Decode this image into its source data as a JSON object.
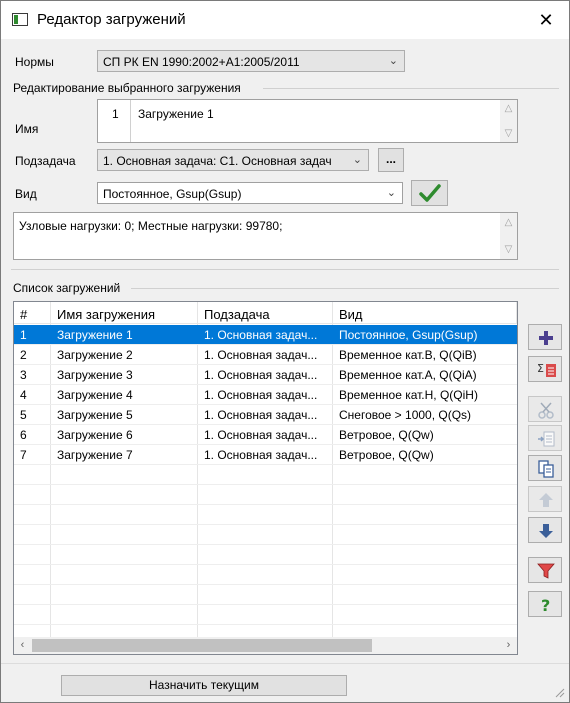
{
  "window": {
    "title": "Редактор загружений",
    "close": "✕"
  },
  "norms": {
    "label": "Нормы",
    "value": "СП РК EN 1990:2002+A1:2005/2011"
  },
  "edit_group": {
    "title": "Редактирование выбранного загружения",
    "name_label": "Имя",
    "name_number": "1",
    "name_value": "Загружение 1",
    "subtask_label": "Подзадача",
    "subtask_value": "1. Основная задача: C1. Основная задач",
    "subtask_button": "...",
    "type_label": "Вид",
    "type_value": "Постоянное, Gsup(Gsup)",
    "info_text": "Узловые нагрузки:  0;  Местные нагрузки:  99780;"
  },
  "list": {
    "title": "Список загружений",
    "columns": [
      "#",
      "Имя загружения",
      "Подзадача",
      "Вид"
    ],
    "rows": [
      [
        "1",
        "Загружение 1",
        "1. Основная задач...",
        "Постоянное, Gsup(Gsup)"
      ],
      [
        "2",
        "Загружение 2",
        "1. Основная задач...",
        "Временное кат.B, Q(QiB)"
      ],
      [
        "3",
        "Загружение 3",
        "1. Основная задач...",
        "Временное кат.A, Q(QiA)"
      ],
      [
        "4",
        "Загружение 4",
        "1. Основная задач...",
        "Временное кат.H, Q(QiH)"
      ],
      [
        "5",
        "Загружение 5",
        "1. Основная задач...",
        "Снеговое > 1000, Q(Qs)"
      ],
      [
        "6",
        "Загружение 6",
        "1. Основная задач...",
        "Ветровое, Q(Qw)"
      ],
      [
        "7",
        "Загружение 7",
        "1. Основная задач...",
        "Ветровое, Q(Qw)"
      ]
    ],
    "selected_row": 1
  },
  "side_buttons": [
    "add-icon",
    "sum-icon",
    "cut-icon",
    "insert-icon",
    "copy-icon",
    "move-up-icon",
    "move-down-icon",
    "filter-icon",
    "help-icon"
  ],
  "assign_button": "Назначить текущим",
  "colors": {
    "selection": "#0078d7",
    "confirm": "#2e8b2e"
  }
}
